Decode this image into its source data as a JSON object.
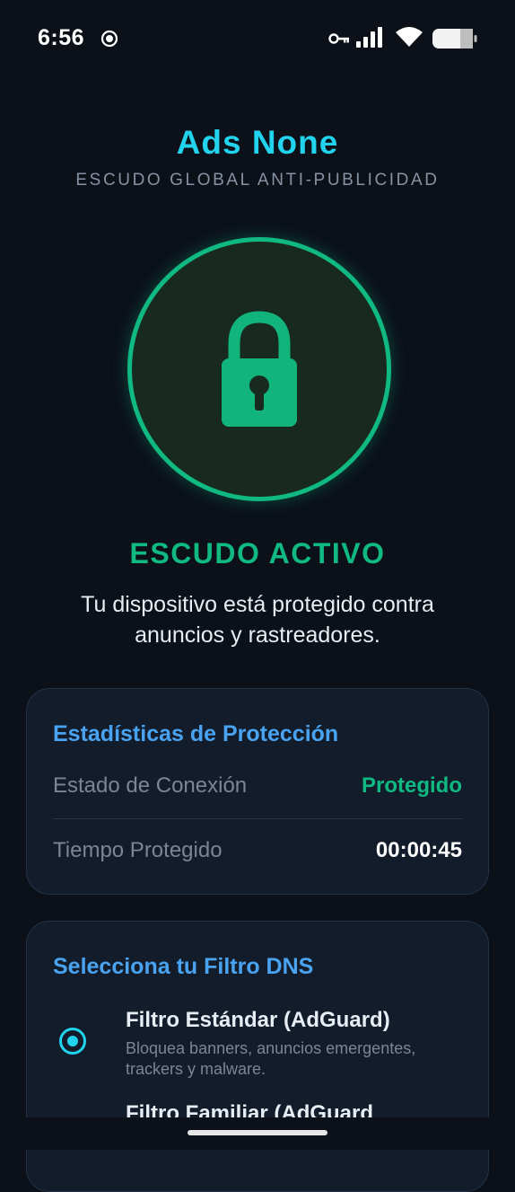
{
  "status_bar": {
    "time": "6:56",
    "icons": [
      "screen-record-icon",
      "vpn-key-icon",
      "signal-icon",
      "wifi-icon",
      "battery-icon"
    ]
  },
  "header": {
    "title": "Ads None",
    "subtitle": "ESCUDO GLOBAL ANTI-PUBLICIDAD"
  },
  "shield": {
    "icon": "lock-icon",
    "status": "ESCUDO ACTIVO",
    "description": "Tu dispositivo está protegido contra anuncios y rastreadores."
  },
  "stats": {
    "title": "Estadísticas de Protección",
    "rows": [
      {
        "label": "Estado de Conexión",
        "value": "Protegido"
      },
      {
        "label": "Tiempo Protegido",
        "value": "00:00:45"
      }
    ]
  },
  "dns": {
    "title": "Selecciona tu Filtro DNS",
    "options": [
      {
        "title": "Filtro Estándar (AdGuard)",
        "description": "Bloquea banners, anuncios emergentes, trackers y malware.",
        "selected": true
      },
      {
        "title": "Filtro Familiar (AdGuard",
        "description": "",
        "selected": false
      }
    ]
  },
  "colors": {
    "accent_cyan": "#22d3ee",
    "active_green": "#10b981",
    "card_title_blue": "#4aa3f0",
    "background": "#0b1019"
  }
}
